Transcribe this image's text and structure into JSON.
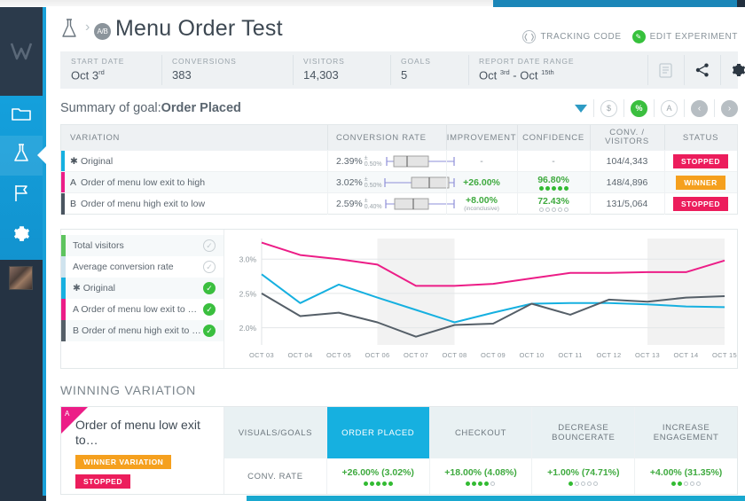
{
  "sidebar": {
    "logo_icon": "vwo-logo-icon",
    "items": [
      {
        "name": "folder",
        "icon": "folder-icon",
        "active": false
      },
      {
        "name": "experiments",
        "icon": "flask-icon",
        "active": true
      },
      {
        "name": "goals",
        "icon": "flag-icon",
        "active": false
      },
      {
        "name": "settings",
        "icon": "gear-icon",
        "active": false
      }
    ],
    "avatar": "user-avatar"
  },
  "header": {
    "flask_icon": "flask-icon",
    "chevron": "›",
    "ab_badge": "A/B",
    "title": "Menu Order Test",
    "actions": [
      {
        "label": "TRACKING CODE",
        "icon": "code-icon",
        "style": "outline"
      },
      {
        "label": "EDIT EXPERIMENT",
        "icon": "pencil-icon",
        "style": "green"
      }
    ]
  },
  "stats": [
    {
      "label": "START DATE",
      "value": "Oct  3",
      "sup": "rd"
    },
    {
      "label": "CONVERSIONS",
      "value": "383",
      "sup": ""
    },
    {
      "label": "VISITORS",
      "value": "14,303",
      "sup": ""
    },
    {
      "label": "GOALS",
      "value": "5",
      "sup": ""
    },
    {
      "label": "REPORT DATE RANGE",
      "value": "Oct ",
      "sup": "3rd",
      "value2": " - Oct ",
      "sup2": "15th"
    }
  ],
  "stat_buttons": [
    {
      "name": "report-icon"
    },
    {
      "name": "share-icon"
    },
    {
      "name": "gear-icon"
    }
  ],
  "summary": {
    "prefix": "Summary of goal:",
    "goal": "Order Placed",
    "controls": [
      {
        "name": "filter-triangle-icon",
        "type": "triangle"
      },
      {
        "name": "revenue-toggle",
        "label": "$",
        "state": "off"
      },
      {
        "name": "percent-toggle",
        "label": "%",
        "state": "on"
      },
      {
        "name": "visitors-toggle",
        "label": "A",
        "state": "off"
      },
      {
        "name": "prev-goal-button",
        "label": "‹",
        "state": "gray"
      },
      {
        "name": "next-goal-button",
        "label": "›",
        "state": "gray"
      }
    ]
  },
  "table": {
    "headers": [
      "VARIATION",
      "CONVERSION RATE",
      "IMPROVEMENT",
      "CONFIDENCE",
      "CONV. / VISITORS",
      "STATUS"
    ],
    "rows": [
      {
        "letter": "✱",
        "name": "Original",
        "color": "#16b0e0",
        "rate": "2.39%",
        "margin": "± 0.50%",
        "box": {
          "low": 0.06,
          "q1": 0.16,
          "med": 0.33,
          "q3": 0.62,
          "high": 0.97
        },
        "improvement": "-",
        "improvement_sub": "",
        "confidence": "-",
        "dots": 0,
        "dots_shown": false,
        "conv_visitors": "104/4,343",
        "status": "STOPPED",
        "status_type": "stopped"
      },
      {
        "letter": "A",
        "name": "Order of menu low exit to high",
        "color": "#ec1d87",
        "rate": "3.02%",
        "margin": "± 0.50%",
        "box": {
          "low": 0.03,
          "q1": 0.39,
          "med": 0.62,
          "q3": 0.89,
          "high": 0.97
        },
        "improvement": "+26.00%",
        "improvement_sub": "",
        "confidence": "96.80%",
        "dots": 5,
        "dots_shown": true,
        "conv_visitors": "148/4,896",
        "status": "WINNER",
        "status_type": "winner"
      },
      {
        "letter": "B",
        "name": "Order of menu high exit to low",
        "color": "#4a5560",
        "rate": "2.59%",
        "margin": "± 0.40%",
        "box": {
          "low": 0.05,
          "q1": 0.18,
          "med": 0.42,
          "q3": 0.64,
          "high": 0.97
        },
        "improvement": "+8.00%",
        "improvement_sub": "(inconclusive)",
        "confidence": "72.43%",
        "dots": 0,
        "dots_shown": true,
        "conv_visitors": "131/5,064",
        "status": "STOPPED",
        "status_type": "stopped"
      }
    ]
  },
  "legend": [
    {
      "label": "Total visitors",
      "color": "#5ec45e",
      "checked": false,
      "letter": ""
    },
    {
      "label": "Average conversion rate",
      "color": "#cfe3ee",
      "checked": false,
      "letter": ""
    },
    {
      "label": "Original",
      "color": "#16b0e0",
      "checked": true,
      "letter": "✱"
    },
    {
      "label": "Order of menu low exit to …",
      "color": "#ec1d87",
      "checked": true,
      "letter": "A"
    },
    {
      "label": "Order of menu high exit to …",
      "color": "#555f68",
      "checked": true,
      "letter": "B"
    }
  ],
  "chart_data": {
    "type": "line",
    "title": "",
    "xlabel": "",
    "ylabel": "",
    "ylim": [
      1.75,
      3.3
    ],
    "yticks": [
      2.0,
      2.5,
      3.0
    ],
    "ytick_labels": [
      "2.0%",
      "2.5%",
      "3.0%"
    ],
    "grid": true,
    "legend_position": "left-panel",
    "categories": [
      "Oct 03",
      "Oct 04",
      "Oct 05",
      "Oct 06",
      "Oct 07",
      "Oct 08",
      "Oct 09",
      "Oct 10",
      "Oct 11",
      "Oct 12",
      "Oct 13",
      "Oct 14",
      "Oct 15"
    ],
    "shaded_bands": [
      [
        3,
        5
      ],
      [
        10,
        12
      ]
    ],
    "series": [
      {
        "name": "Order of menu low exit to high",
        "letter": "A",
        "color": "#ec1d87",
        "values": [
          3.24,
          3.06,
          3.0,
          2.92,
          2.61,
          2.61,
          2.64,
          2.72,
          2.8,
          2.8,
          2.81,
          2.81,
          2.98
        ]
      },
      {
        "name": "Original",
        "letter": "*",
        "color": "#16b0e0",
        "values": [
          2.78,
          2.36,
          2.63,
          2.44,
          2.26,
          2.08,
          2.22,
          2.35,
          2.36,
          2.36,
          2.34,
          2.31,
          2.3
        ]
      },
      {
        "name": "Order of menu high exit to low",
        "letter": "B",
        "color": "#555f68",
        "values": [
          2.5,
          2.17,
          2.22,
          2.08,
          1.87,
          2.04,
          2.06,
          2.35,
          2.19,
          2.41,
          2.38,
          2.44,
          2.46
        ]
      }
    ]
  },
  "winning": {
    "section_title": "WINNING VARIATION",
    "letter": "A",
    "name": "Order of menu low exit to…",
    "badges": [
      {
        "label": "WINNER VARIATION",
        "type": "winner"
      },
      {
        "label": "STOPPED",
        "type": "stopped"
      }
    ],
    "columns": [
      {
        "header": "VISUALS/GOALS",
        "value": "CONV. RATE",
        "highlight": false,
        "is_label": true
      },
      {
        "header": "ORDER PLACED",
        "value": "+26.00%  (3.02%)",
        "dots": 5,
        "highlight": true
      },
      {
        "header": "CHECKOUT",
        "value": "+18.00%  (4.08%)",
        "dots": 4,
        "highlight": false
      },
      {
        "header": "DECREASE BOUNCERATE",
        "value": "+1.00%  (74.71%)",
        "dots": 1,
        "highlight": false
      },
      {
        "header": "INCREASE ENGAGEMENT",
        "value": "+4.00%  (31.35%)",
        "dots": 2,
        "highlight": false
      }
    ]
  },
  "colors": {
    "accent_blue": "#16b0e0",
    "pink": "#ec1d87",
    "green": "#3bbf3f",
    "orange": "#f5a01e",
    "red": "#ec1d5c",
    "dark": "#253343"
  }
}
